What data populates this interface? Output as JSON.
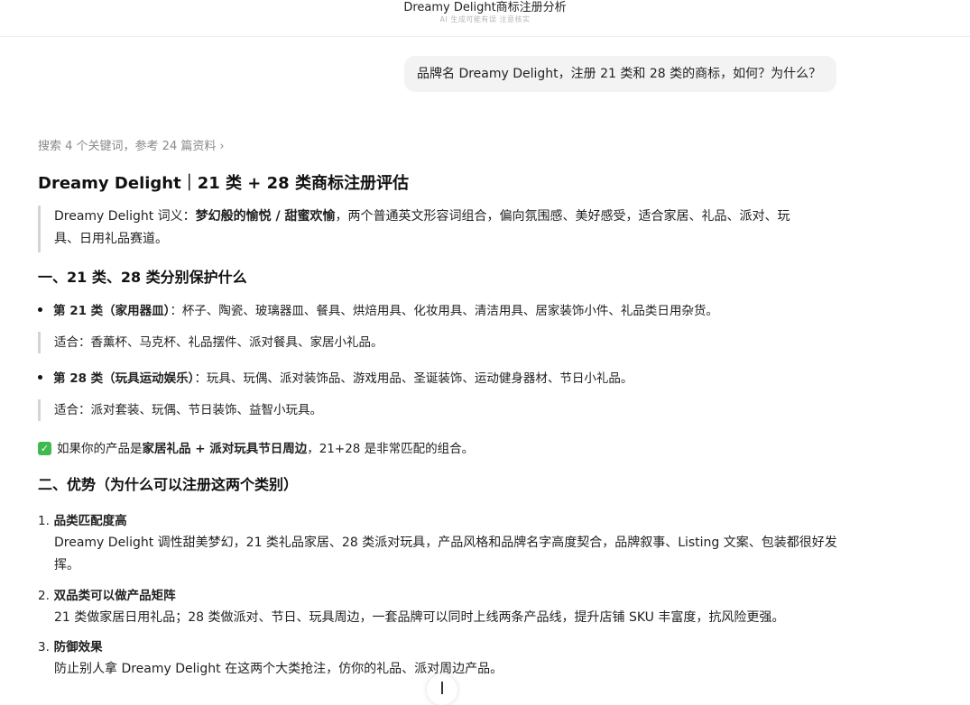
{
  "header": {
    "title": "Dreamy Delight商标注册分析",
    "subtitle": "AI 生成可能有误 注意核实"
  },
  "user_message": "品牌名 Dreamy Delight，注册 21 类和 28 类的商标，如何？为什么？",
  "search_summary": "搜索 4 个关键词，参考 24 篇资料",
  "answer": {
    "title": "Dreamy Delight｜21 类 + 28 类商标注册评估",
    "intro": {
      "prefix": "Dreamy Delight 词义：",
      "bold": "梦幻般的愉悦 / 甜蜜欢愉",
      "rest": "，两个普通英文形容词组合，偏向氛围感、美好感受，适合家居、礼品、派对、玩具、日用礼品赛道。"
    },
    "section1": {
      "heading": "一、21 类、28 类分别保护什么",
      "class21": {
        "label": "第 21 类（家用器皿）",
        "text": "：杯子、陶瓷、玻璃器皿、餐具、烘焙用具、化妆用具、清洁用具、居家装饰小件、礼品类日用杂货。",
        "fit": "适合：香薰杯、马克杯、礼品摆件、派对餐具、家居小礼品。"
      },
      "class28": {
        "label": "第 28 类（玩具运动娱乐）",
        "text": "：玩具、玩偶、派对装饰品、游戏用品、圣诞装饰、运动健身器材、节日小礼品。",
        "fit": "适合：派对套装、玩偶、节日装饰、益智小玩具。"
      },
      "conclusion": {
        "prefix": "如果你的产品是",
        "bold": "家居礼品 + 派对玩具节日周边",
        "rest": "，21+28 是非常匹配的组合。"
      }
    },
    "section2": {
      "heading": "二、优势（为什么可以注册这两个类别）",
      "items": [
        {
          "num": "1.",
          "title": "品类匹配度高",
          "body": "Dreamy Delight 调性甜美梦幻，21 类礼品家居、28 类派对玩具，产品风格和品牌名字高度契合，品牌叙事、Listing 文案、包装都很好发挥。"
        },
        {
          "num": "2.",
          "title": "双品类可以做产品矩阵",
          "body": "21 类做家居日用礼品；28 类做派对、节日、玩具周边，一套品牌可以同时上线两条产品线，提升店铺 SKU 丰富度，抗风险更强。"
        },
        {
          "num": "3.",
          "title": "防御效果",
          "body": "防止别人拿 Dreamy Delight 在这两个大类抢注，仿你的礼品、派对周边产品。"
        }
      ]
    }
  },
  "icons": {
    "check": "check-mark-icon",
    "chevron": "chevron-right-icon",
    "scroll": "scroll-down-icon"
  },
  "colors": {
    "check_green": "#3fb950",
    "bubble_bg": "#f3f3f3",
    "quote_bar": "#d4d4d4"
  }
}
